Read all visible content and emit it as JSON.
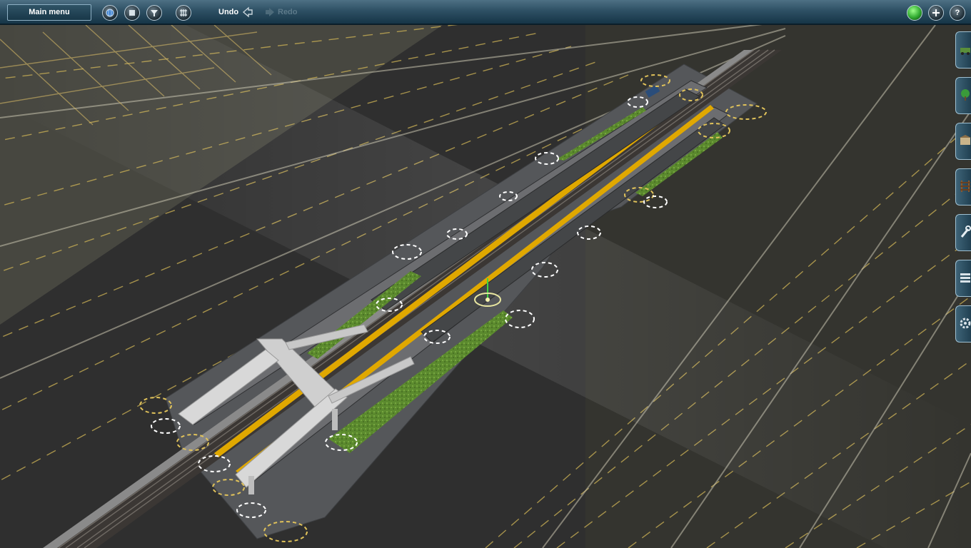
{
  "toolbar": {
    "main_menu_label": "Main menu",
    "undo_label": "Undo",
    "redo_label": "Redo"
  },
  "toolbar_left_icons": [
    "globe-icon",
    "stop-icon",
    "filter-icon",
    "grid-icon"
  ],
  "toolbar_right_icons": [
    "status-light-icon",
    "add-icon",
    "help-icon"
  ],
  "side_tools": [
    "train-tool",
    "tree-tool",
    "building-tool",
    "track-tool",
    "wrench-tool",
    "layers-tool",
    "settings-tool"
  ],
  "colors": {
    "toolbar_top": "#4d7084",
    "toolbar_bottom": "#163547",
    "status_light": "#3fd43f",
    "platform_yellow": "#e0a800",
    "grid_yellow": "#e0c25a",
    "ground": "#2f2f2f"
  }
}
